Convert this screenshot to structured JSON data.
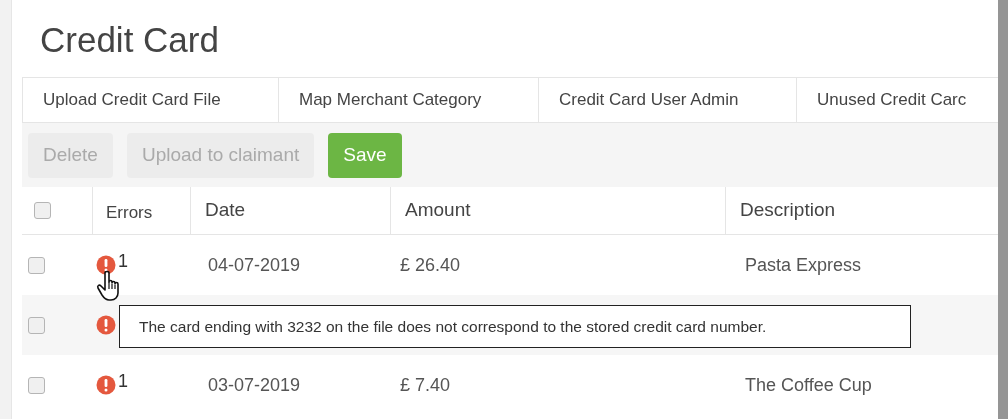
{
  "title": "Credit Card",
  "tabs": [
    {
      "label": "Upload Credit Card File",
      "selected": false
    },
    {
      "label": "Map Merchant Category",
      "selected": false
    },
    {
      "label": "Credit Card User Admin",
      "selected": false
    },
    {
      "label": "Unused Credit Carc",
      "selected": false
    }
  ],
  "toolbar": [
    {
      "label": "Delete",
      "disabled": true
    },
    {
      "label": "Upload to claimant",
      "disabled": true
    },
    {
      "label": "Save",
      "disabled": false
    }
  ],
  "table": {
    "select_all": {
      "checked": false
    },
    "columns": [
      "Errors",
      "Date",
      "Amount",
      "Description"
    ],
    "rows": [
      {
        "checked": false,
        "error_count": "1",
        "date": "04-07-2019",
        "amount": "£ 26.40",
        "description": "Pasta Express"
      },
      {
        "checked": false
      },
      {
        "checked": false,
        "error_count": "1",
        "date": "03-07-2019",
        "amount": "£ 7.40",
        "description": "The Coffee Cup"
      }
    ]
  },
  "tooltip": {
    "text": "The card ending with 3232 on the file does not correspond to the stored credit card number."
  }
}
